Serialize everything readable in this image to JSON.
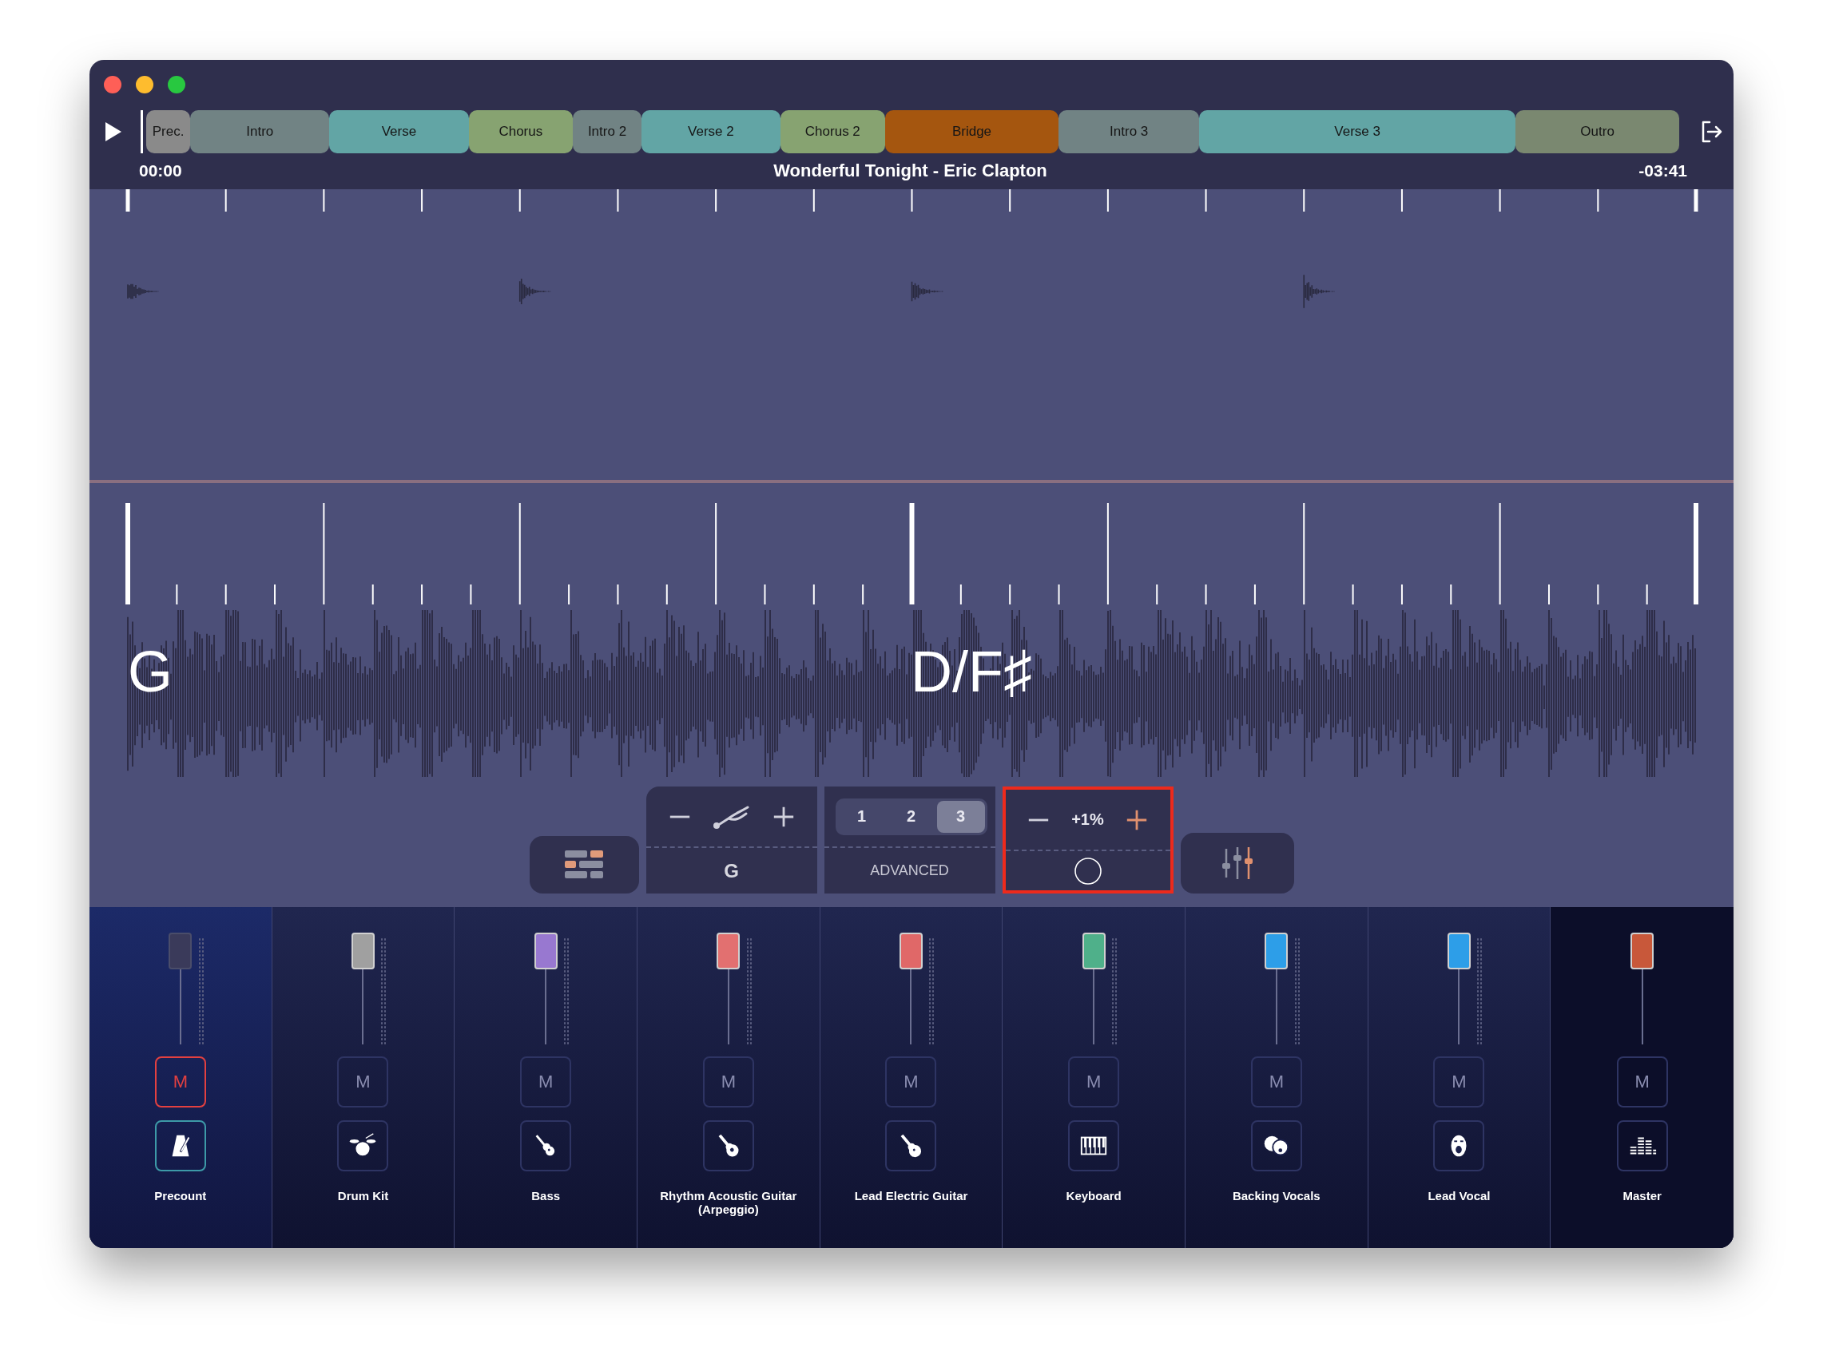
{
  "sections": [
    {
      "label": "Prec.",
      "color": "#8a8a8a"
    },
    {
      "label": "Intro",
      "color": "#718384"
    },
    {
      "label": "Verse",
      "color": "#62a5a5"
    },
    {
      "label": "Chorus",
      "color": "#87a371"
    },
    {
      "label": "Intro 2",
      "color": "#718384"
    },
    {
      "label": "Verse 2",
      "color": "#62a5a5"
    },
    {
      "label": "Chorus 2",
      "color": "#87a371"
    },
    {
      "label": "Bridge",
      "color": "#a5560f"
    },
    {
      "label": "Intro 3",
      "color": "#718384"
    },
    {
      "label": "Verse 3",
      "color": "#62a5a5"
    },
    {
      "label": "Outro",
      "color": "#7a8870"
    }
  ],
  "song": {
    "elapsed": "00:00",
    "title": "Wonderful Tonight - Eric Clapton",
    "remaining": "-03:41"
  },
  "chords": [
    {
      "label": "G"
    },
    {
      "label": "D/F♯"
    }
  ],
  "controls": {
    "key": "G",
    "modes": [
      {
        "label": "1",
        "selected": false
      },
      {
        "label": "2",
        "selected": false
      },
      {
        "label": "3",
        "selected": true
      }
    ],
    "mode_label": "ADVANCED",
    "tempo": {
      "value": "+1%",
      "highlighted": true
    }
  },
  "channels": [
    {
      "name": "Precount",
      "kind": "metronome",
      "color": "#3a3a5a",
      "level": 1,
      "mute_label": "M",
      "muted": true,
      "selected": true
    },
    {
      "name": "Drum Kit",
      "kind": "drums",
      "color": "#a0a0a0",
      "level": 1,
      "mute_label": "M",
      "muted": false,
      "selected": false
    },
    {
      "name": "Bass",
      "kind": "bass",
      "color": "#9878d0",
      "level": 1,
      "mute_label": "M",
      "muted": false,
      "selected": false
    },
    {
      "name": "Rhythm Acoustic Guitar (Arpeggio)",
      "kind": "acoustic",
      "color": "#e27070",
      "level": 1,
      "mute_label": "M",
      "muted": false,
      "selected": false
    },
    {
      "name": "Lead Electric Guitar",
      "kind": "electric",
      "color": "#e06868",
      "level": 1,
      "mute_label": "M",
      "muted": false,
      "selected": false
    },
    {
      "name": "Keyboard",
      "kind": "keys",
      "color": "#4fb08a",
      "level": 1,
      "mute_label": "M",
      "muted": false,
      "selected": false
    },
    {
      "name": "Backing Vocals",
      "kind": "choir",
      "color": "#2d9ee8",
      "level": 1,
      "mute_label": "M",
      "muted": false,
      "selected": false
    },
    {
      "name": "Lead Vocal",
      "kind": "singer",
      "color": "#2d9ee8",
      "level": 1,
      "mute_label": "M",
      "muted": false,
      "selected": false
    },
    {
      "name": "Master",
      "kind": "master",
      "color": "#c8583a",
      "level": 1,
      "mute_label": "M",
      "muted": false,
      "selected": false
    }
  ]
}
